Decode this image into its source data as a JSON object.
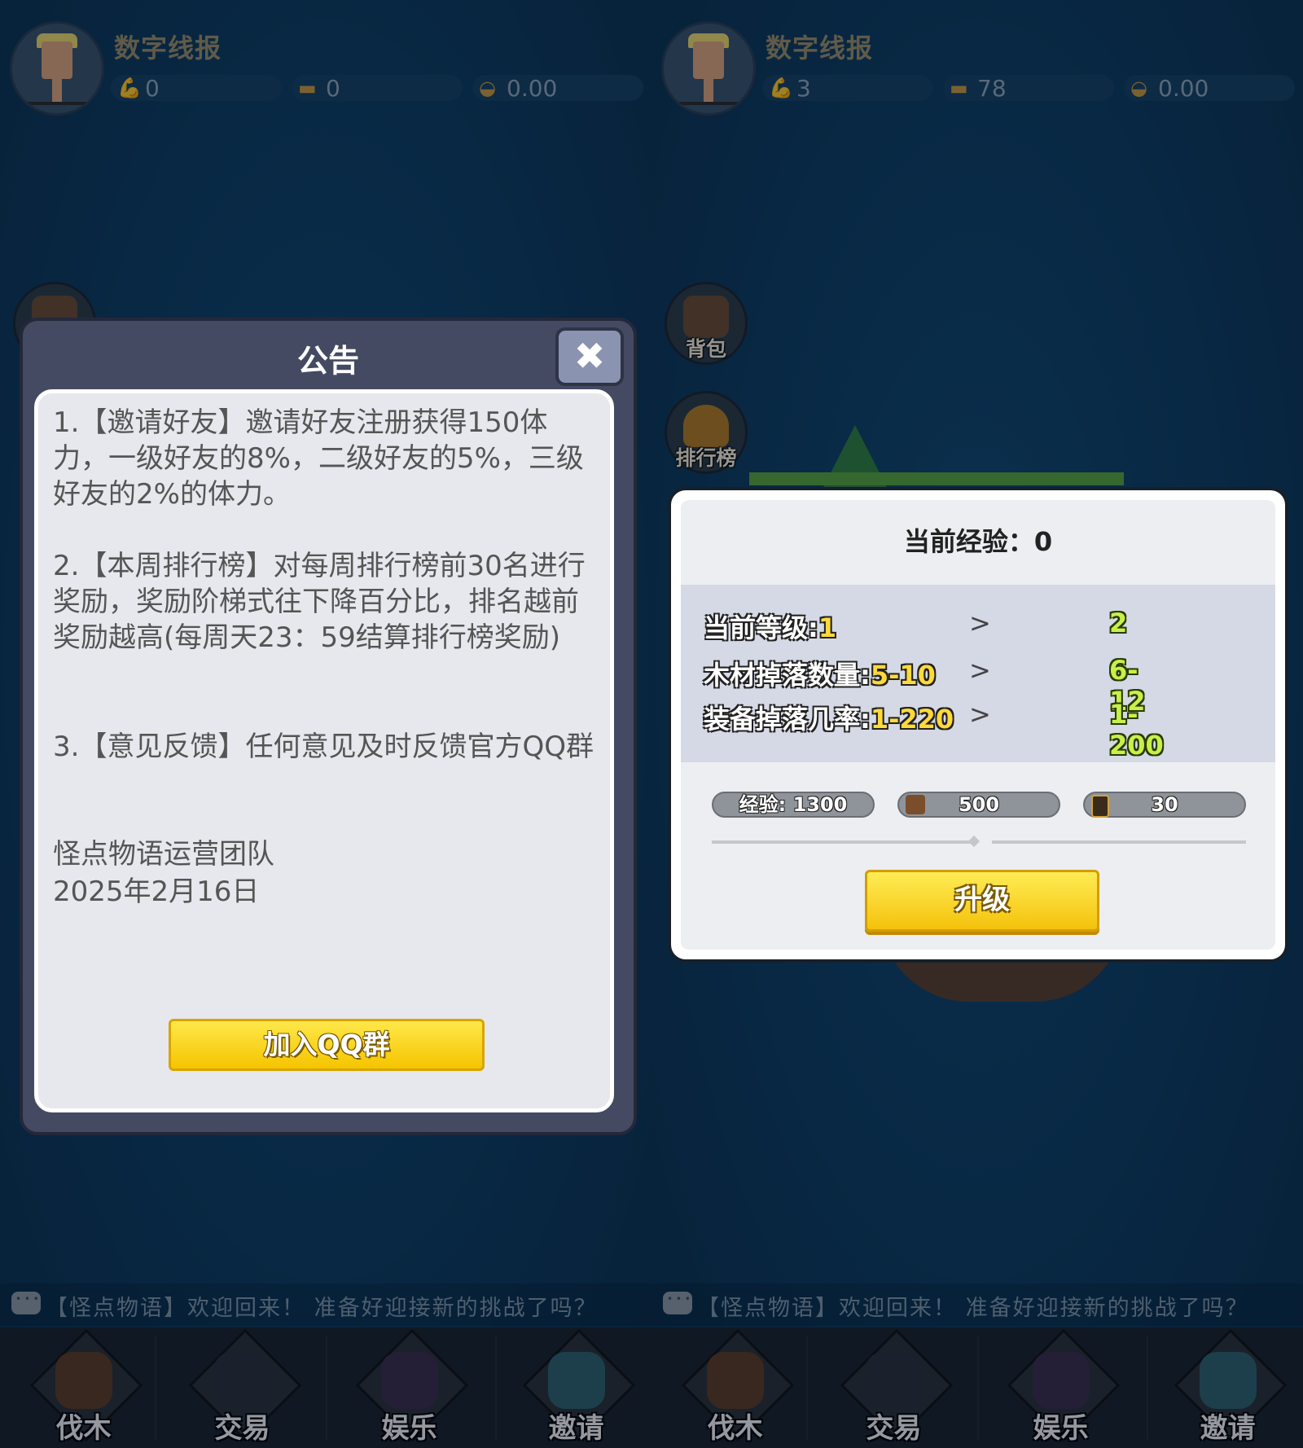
{
  "left": {
    "player": {
      "name": "数字线报",
      "stamina": "0",
      "wood": "0",
      "gold": "0.00"
    },
    "announcement": {
      "title": "公告",
      "close_icon": "close-icon",
      "p1": "1.【邀请好友】邀请好友注册获得150体力，一级好友的8%，二级好友的5%，三级好友的2%的体力。",
      "p2": "2.【本周排行榜】对每周排行榜前30名进行奖励，奖励阶梯式往下降百分比，排名越前奖励越高(每周天23：59结算排行榜奖励)",
      "p3": "3.【意见反馈】任何意见及时反馈官方QQ群",
      "signature": "怪点物语运营团队",
      "date": "2025年2月16日",
      "join_button": "加入QQ群"
    }
  },
  "right": {
    "player": {
      "name": "数字线报",
      "stamina": "3",
      "wood": "78",
      "gold": "0.00"
    },
    "side_buttons": [
      {
        "label": "背包",
        "icon": "backpack-icon"
      },
      {
        "label": "排行榜",
        "icon": "trophy-icon"
      }
    ],
    "upgrade": {
      "current_exp_label": "当前经验：0",
      "level_label": "当前等级:",
      "level_current": "1",
      "level_next": "2",
      "wood_drop_label": "木材掉落数量:",
      "wood_drop_current": "5-10",
      "wood_drop_next": "6-12",
      "equip_rate_label": "装备掉落几率:",
      "equip_rate_current": "1-220",
      "equip_rate_next": "1-200",
      "arrow": ">",
      "cost_exp": "经验: 1300",
      "cost_wood": "500",
      "cost_book": "30",
      "upgrade_button": "升级"
    }
  },
  "news_ticker": "【怪点物语】欢迎回来！ 准备好迎接新的挑战了吗？",
  "bottom_nav": [
    {
      "label": "伐木",
      "icon": "log-icon"
    },
    {
      "label": "交易",
      "icon": "scale-icon"
    },
    {
      "label": "娱乐",
      "icon": "bomb-icon"
    },
    {
      "label": "邀请",
      "icon": "gift-icon"
    }
  ],
  "colors": {
    "ocean": "#0e3a5c",
    "button_yellow": "#f5c400",
    "modal_frame": "#444a62"
  }
}
